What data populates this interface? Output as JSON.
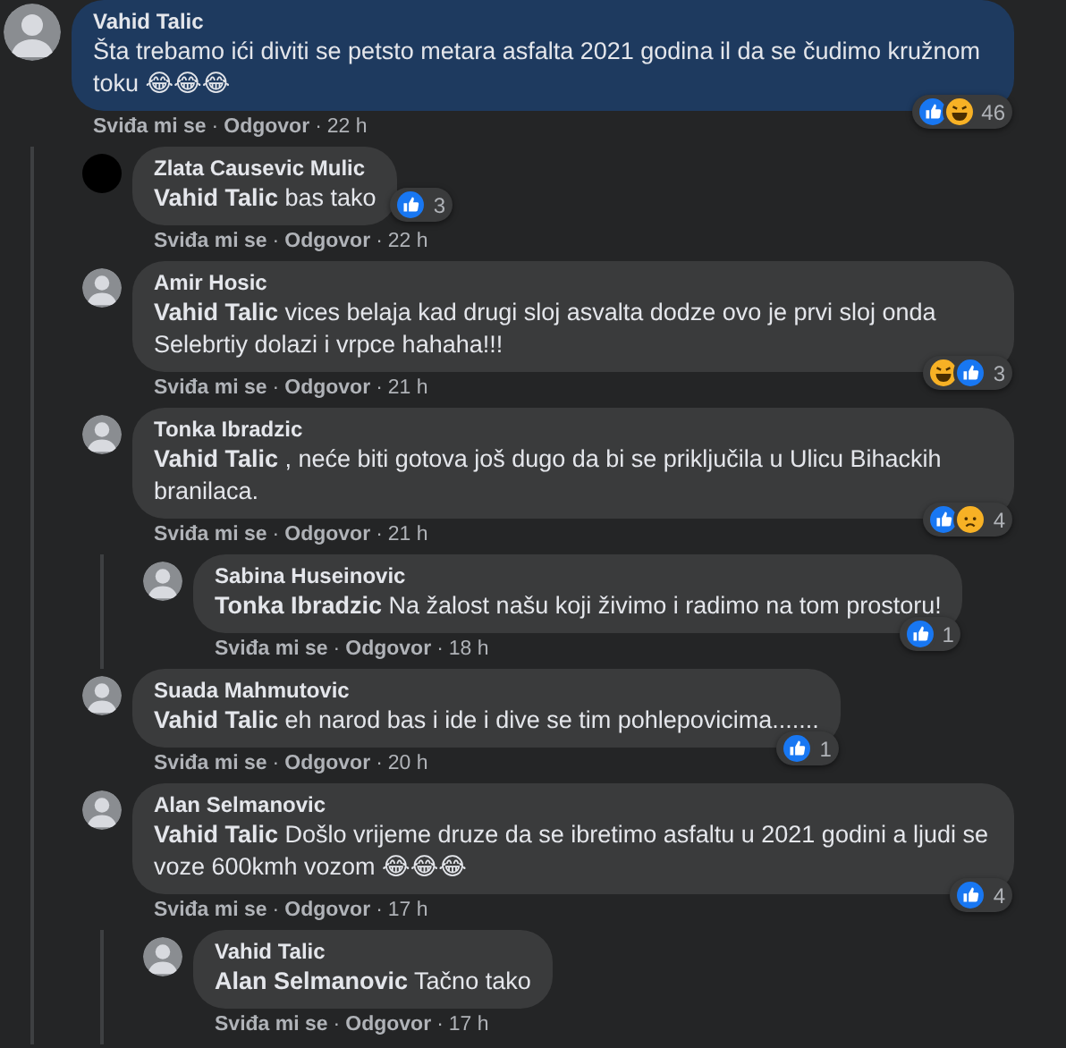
{
  "comments": [
    {
      "author": "Vahid Talic",
      "avatar": {
        "kind": "photo"
      },
      "highlighted": true,
      "text": "Šta trebamo ići diviti se petsto metara asfalta 2021 godina il da se čudimo kružnom toku 😂😂😂",
      "reactions": {
        "icons": [
          {
            "kind": "like"
          },
          {
            "kind": "haha"
          }
        ],
        "count": "46"
      },
      "actions": [
        {
          "kind": "link",
          "text": "Sviđa mi se"
        },
        {
          "kind": "separator",
          "text": "·"
        },
        {
          "kind": "link",
          "text": "Odgovor"
        },
        {
          "kind": "separator",
          "text": "·"
        },
        {
          "kind": "time",
          "text": "22 h"
        }
      ],
      "children": [
        {
          "author": "Zlata Causevic Mulic",
          "avatar": {
            "kind": "blank"
          },
          "highlighted": false,
          "text": "**Vahid Talic** bas tako",
          "reactions": {
            "icons": [
              {
                "kind": "like"
              }
            ],
            "count": "3"
          },
          "actions": [
            {
              "kind": "link",
              "text": "Sviđa mi se"
            },
            {
              "kind": "separator",
              "text": "·"
            },
            {
              "kind": "link",
              "text": "Odgovor"
            },
            {
              "kind": "separator",
              "text": "·"
            },
            {
              "kind": "time",
              "text": "22 h"
            }
          ]
        },
        {
          "author": "Amir Hosic",
          "avatar": {
            "kind": "photo"
          },
          "highlighted": false,
          "text": "**Vahid Talic** vices belaja kad drugi sloj asvalta dodze ovo je prvi sloj onda Selebrtiy dolazi i vrpce hahaha!!!",
          "reactions": {
            "icons": [
              {
                "kind": "haha"
              },
              {
                "kind": "like"
              }
            ],
            "count": "3"
          },
          "actions": [
            {
              "kind": "link",
              "text": "Sviđa mi se"
            },
            {
              "kind": "separator",
              "text": "·"
            },
            {
              "kind": "link",
              "text": "Odgovor"
            },
            {
              "kind": "separator",
              "text": "·"
            },
            {
              "kind": "time",
              "text": "21 h"
            }
          ]
        },
        {
          "author": "Tonka Ibradzic",
          "avatar": {
            "kind": "photo"
          },
          "highlighted": false,
          "text": "**Vahid Talic** , neće biti gotova još dugo da bi se priključila u Ulicu Bihackih branilaca.",
          "reactions": {
            "icons": [
              {
                "kind": "like"
              },
              {
                "kind": "sad"
              }
            ],
            "count": "4"
          },
          "actions": [
            {
              "kind": "link",
              "text": "Sviđa mi se"
            },
            {
              "kind": "separator",
              "text": "·"
            },
            {
              "kind": "link",
              "text": "Odgovor"
            },
            {
              "kind": "separator",
              "text": "·"
            },
            {
              "kind": "time",
              "text": "21 h"
            }
          ],
          "children": [
            {
              "author": "Sabina Huseinovic",
              "avatar": {
                "kind": "photo"
              },
              "highlighted": false,
              "text": "**Tonka Ibradzic** Na žalost našu koji živimo i radimo na tom prostoru!",
              "reactions": {
                "icons": [
                  {
                    "kind": "like"
                  }
                ],
                "count": "1"
              },
              "actions": [
                {
                  "kind": "link",
                  "text": "Sviđa mi se"
                },
                {
                  "kind": "separator",
                  "text": "·"
                },
                {
                  "kind": "link",
                  "text": "Odgovor"
                },
                {
                  "kind": "separator",
                  "text": "·"
                },
                {
                  "kind": "time",
                  "text": "18 h"
                }
              ]
            }
          ]
        },
        {
          "author": "Suada Mahmutovic",
          "avatar": {
            "kind": "photo"
          },
          "highlighted": false,
          "text": "**Vahid Talic** eh narod bas i ide i dive se tim pohlepovicima.......",
          "reactions": {
            "icons": [
              {
                "kind": "like"
              }
            ],
            "count": "1"
          },
          "actions": [
            {
              "kind": "link",
              "text": "Sviđa mi se"
            },
            {
              "kind": "separator",
              "text": "·"
            },
            {
              "kind": "link",
              "text": "Odgovor"
            },
            {
              "kind": "separator",
              "text": "·"
            },
            {
              "kind": "time",
              "text": "20 h"
            }
          ]
        },
        {
          "author": "Alan Selmanovic",
          "avatar": {
            "kind": "photo"
          },
          "highlighted": false,
          "text": "**Vahid Talic** Došlo vrijeme druze da se ibretimo asfaltu u 2021 godini a ljudi se voze 600kmh vozom 😂😂😂",
          "reactions": {
            "icons": [
              {
                "kind": "like"
              }
            ],
            "count": "4"
          },
          "actions": [
            {
              "kind": "link",
              "text": "Sviđa mi se"
            },
            {
              "kind": "separator",
              "text": "·"
            },
            {
              "kind": "link",
              "text": "Odgovor"
            },
            {
              "kind": "separator",
              "text": "·"
            },
            {
              "kind": "time",
              "text": "17 h"
            }
          ],
          "children": [
            {
              "author": "Vahid Talic",
              "avatar": {
                "kind": "photo"
              },
              "highlighted": false,
              "text": "**Alan Selmanovic** Tačno tako",
              "actions": [
                {
                  "kind": "link",
                  "text": "Sviđa mi se"
                },
                {
                  "kind": "separator",
                  "text": "·"
                },
                {
                  "kind": "link",
                  "text": "Odgovor"
                },
                {
                  "kind": "separator",
                  "text": "·"
                },
                {
                  "kind": "time",
                  "text": "17 h"
                }
              ]
            }
          ]
        }
      ]
    }
  ]
}
